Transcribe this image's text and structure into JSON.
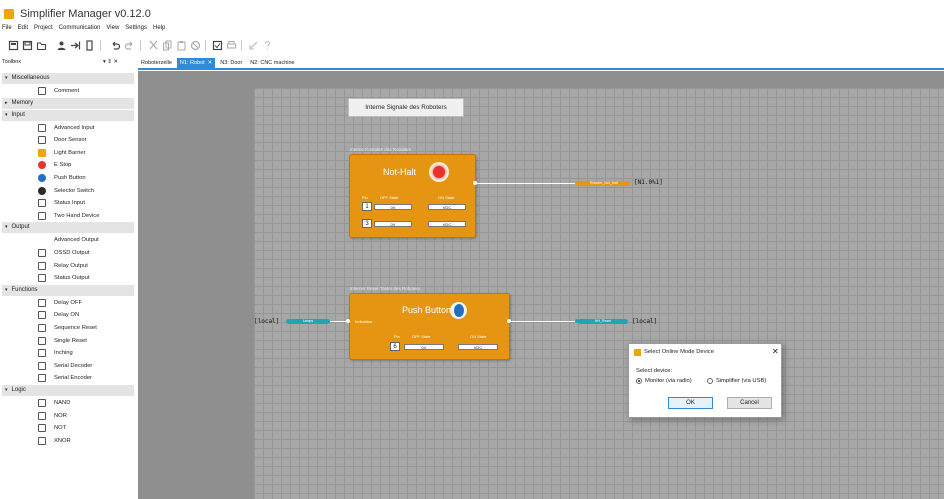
{
  "app": {
    "title": "Simplifier Manager v0.12.0"
  },
  "menu": [
    "File",
    "Edit",
    "Project",
    "Communication",
    "View",
    "Settings",
    "Help"
  ],
  "toolbar": {
    "icons": [
      "new-icon",
      "save-icon",
      "open-icon",
      "user-icon",
      "connect-icon",
      "device-icon",
      "undo-icon",
      "redo-icon",
      "cut-icon",
      "copy-icon",
      "paste-icon",
      "delete-icon",
      "check-icon",
      "print-icon",
      "link-icon",
      "help-icon"
    ]
  },
  "toolbox": {
    "label": "Toolbox",
    "controls": "▾ ⇕ ✕"
  },
  "tabs": [
    {
      "label": "Roboterzelle",
      "active": false
    },
    {
      "label": "N1: Robot",
      "active": true,
      "close": "✕"
    },
    {
      "label": "N3: Door",
      "active": false
    },
    {
      "label": "N2: CNC machine",
      "active": false
    }
  ],
  "sidebar": {
    "categories": [
      {
        "label": "Miscellaneous",
        "expanded": true,
        "items": [
          {
            "label": "Comment",
            "icon": "comment-icon"
          }
        ]
      },
      {
        "label": "Memory",
        "expanded": false,
        "items": []
      },
      {
        "label": "Input",
        "expanded": true,
        "items": [
          {
            "label": "Advanced Input",
            "icon": "advanced-input-icon"
          },
          {
            "label": "Door Sensor",
            "icon": "door-sensor-icon"
          },
          {
            "label": "Light Barrier",
            "icon": "light-barrier-icon"
          },
          {
            "label": "E Stop",
            "icon": "e-stop-icon"
          },
          {
            "label": "Push Button",
            "icon": "push-button-icon"
          },
          {
            "label": "Selector Switch",
            "icon": "selector-switch-icon"
          },
          {
            "label": "Status Input",
            "icon": "status-input-icon"
          },
          {
            "label": "Two Hand Device",
            "icon": "two-hand-device-icon"
          }
        ]
      },
      {
        "label": "Output",
        "expanded": true,
        "items": [
          {
            "label": "Advanced Output",
            "icon": ""
          },
          {
            "label": "OSSD Output",
            "icon": "ossd-output-icon"
          },
          {
            "label": "Relay Output",
            "icon": "relay-output-icon"
          },
          {
            "label": "Status Output",
            "icon": "status-output-icon"
          }
        ]
      },
      {
        "label": "Functions",
        "expanded": true,
        "items": [
          {
            "label": "Delay OFF",
            "icon": "delay-off-icon"
          },
          {
            "label": "Delay ON",
            "icon": "delay-on-icon"
          },
          {
            "label": "Sequence Reset",
            "icon": "sequence-reset-icon"
          },
          {
            "label": "Single Reset",
            "icon": "single-reset-icon"
          },
          {
            "label": "Inching",
            "icon": "inching-icon"
          },
          {
            "label": "Serial Decoder",
            "icon": "serial-decoder-icon"
          },
          {
            "label": "Serial Encoder",
            "icon": "serial-encoder-icon"
          }
        ]
      },
      {
        "label": "Logic",
        "expanded": true,
        "items": [
          {
            "label": "NAND",
            "icon": "nand-icon"
          },
          {
            "label": "NOR",
            "icon": "nor-icon"
          },
          {
            "label": "NOT",
            "icon": "not-icon"
          },
          {
            "label": "XNOR",
            "icon": "xnor-icon"
          }
        ]
      }
    ]
  },
  "diagram": {
    "header_button": "Interne Signale des Roboters",
    "block1": {
      "group_label": "Interne Kontakte des Roboters",
      "title": "Not-Halt",
      "col_pin": "Pin",
      "col_off": "OFF State",
      "col_on": "ON State",
      "rows": [
        {
          "pin": "1",
          "off": "0V",
          "on": "VDC"
        },
        {
          "pin": "3",
          "off": "0V",
          "on": "VDC"
        }
      ],
      "output_label": "Roboter_Not_Halt",
      "output_ref": "[N1.0%1]",
      "lamp_color": "#e8332d"
    },
    "block2": {
      "group_label": "Interner Reset-Taster des Roboters",
      "title": "Push Button",
      "indication": "Indication",
      "col_pin": "Pin",
      "col_off": "OFF State",
      "col_on": "ON State",
      "rows": [
        {
          "pin": "6",
          "off": "0V",
          "on": "VDC"
        }
      ],
      "input_ref": "[local]",
      "input_label": "Lamps",
      "output_label": "NH_Reset",
      "output_ref": "[local]",
      "button_color": "#1f6fc4"
    }
  },
  "dialog": {
    "title": "Select Online Mode Device",
    "close": "✕",
    "select_label": "Select device:",
    "options": [
      {
        "label": "Monitor (via radio)",
        "selected": true
      },
      {
        "label": "Simplifier (via USB)",
        "selected": false
      }
    ],
    "ok": "OK",
    "cancel": "Cancel"
  },
  "colors": {
    "accent": "#2e8bd8",
    "block": "#e59511",
    "wire_label_orange": "#e59511",
    "wire_label_teal": "#25a3b5"
  }
}
